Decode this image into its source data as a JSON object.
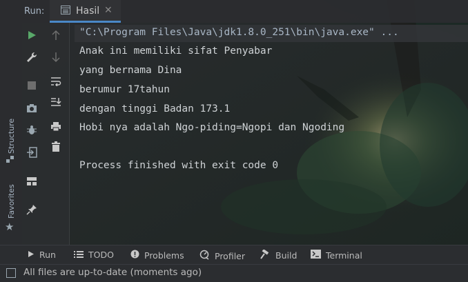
{
  "header": {
    "run_label": "Run:",
    "tab_label": "Hasil"
  },
  "side": {
    "structure_label": "Structure",
    "favorites_label": "Favorites"
  },
  "console": {
    "lines": [
      "\"C:\\Program Files\\Java\\jdk1.8.0_251\\bin\\java.exe\" ...",
      "Anak ini memiliki sifat Penyabar",
      "yang bernama Dina",
      "berumur 17tahun",
      "dengan tinggi Badan 173.1",
      "Hobi nya adalah Ngo-piding=Ngopi dan Ngoding",
      "",
      "Process finished with exit code 0"
    ]
  },
  "bottom_tools": {
    "run": "Run",
    "todo": "TODO",
    "problems": "Problems",
    "profiler": "Profiler",
    "build": "Build",
    "terminal": "Terminal"
  },
  "status": {
    "text": "All files are up-to-date (moments ago)"
  },
  "colors": {
    "accent_tab": "#4a88c7",
    "run_green": "#59a869",
    "console_text": "#cfd3d6"
  }
}
